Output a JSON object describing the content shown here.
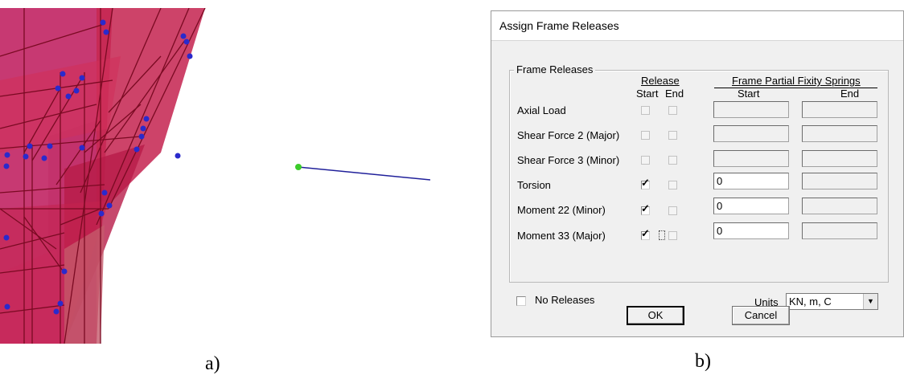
{
  "viewport": {
    "description_icon": "3d-frame-model"
  },
  "dialog": {
    "title": "Assign Frame Releases",
    "group_title": "Frame Releases",
    "headers": {
      "release": "Release",
      "start": "Start",
      "end": "End",
      "springs": "Frame Partial Fixity Springs",
      "springs_start": "Start",
      "springs_end": "End"
    },
    "rows": [
      {
        "label": "Axial Load",
        "start_checked": false,
        "end_checked": false,
        "spring_start": "",
        "spring_end": ""
      },
      {
        "label": "Shear Force 2 (Major)",
        "start_checked": false,
        "end_checked": false,
        "spring_start": "",
        "spring_end": ""
      },
      {
        "label": "Shear Force 3 (Minor)",
        "start_checked": false,
        "end_checked": false,
        "spring_start": "",
        "spring_end": ""
      },
      {
        "label": "Torsion",
        "start_checked": true,
        "end_checked": false,
        "spring_start": "0",
        "spring_end": ""
      },
      {
        "label": "Moment 22 (Minor)",
        "start_checked": true,
        "end_checked": false,
        "spring_start": "0",
        "spring_end": ""
      },
      {
        "label": "Moment 33 (Major)",
        "start_checked": true,
        "end_checked": false,
        "spring_start": "0",
        "spring_end": ""
      }
    ],
    "no_releases_label": "No Releases",
    "no_releases_checked": false,
    "units_label": "Units",
    "units_value": "KN, m, C",
    "ok_label": "OK",
    "cancel_label": "Cancel"
  },
  "captions": {
    "a": "a)",
    "b": "b)"
  },
  "colors": {
    "frame_fill": "#c4224f",
    "frame_edge": "#7a0a22",
    "frame_pink": "#c868d2",
    "node_blue": "#2a2acc",
    "node_green": "#3ccc2a",
    "line_blue": "#20209a"
  }
}
